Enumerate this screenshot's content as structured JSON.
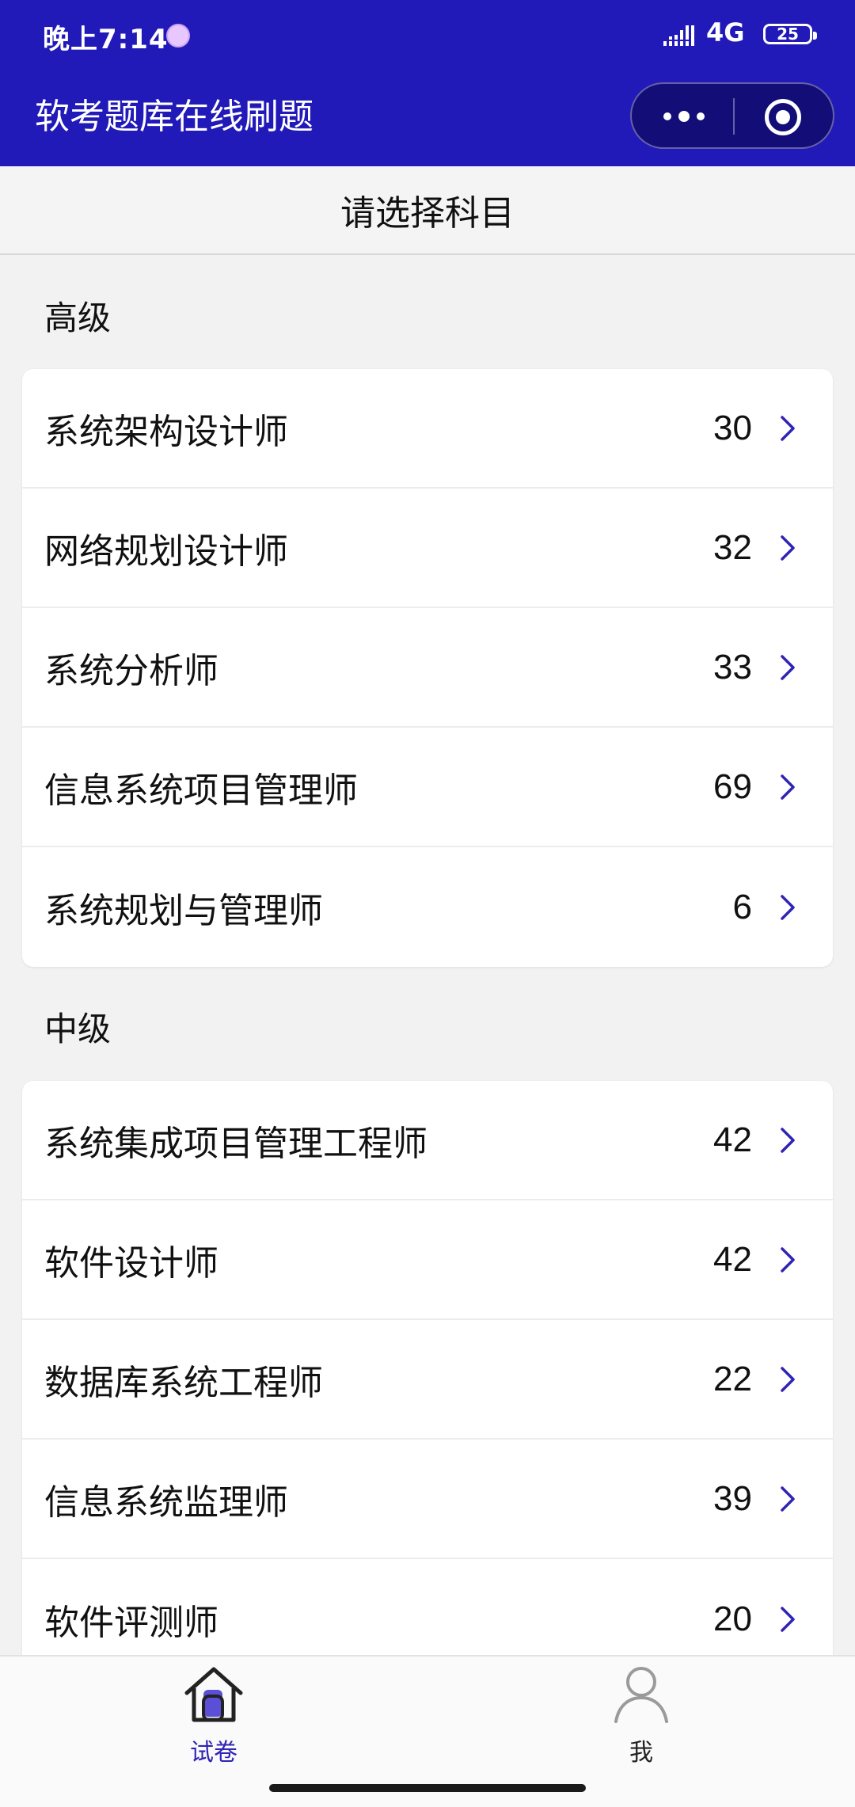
{
  "status": {
    "time": "晚上7:14",
    "network": "4G",
    "battery": "25"
  },
  "titlebar": {
    "title": "软考题库在线刷题",
    "more_icon": "more-dots-icon",
    "target_icon": "target-icon"
  },
  "header": {
    "title": "请选择科目"
  },
  "sections": [
    {
      "title": "高级",
      "items": [
        {
          "label": "系统架构设计师",
          "count": "30"
        },
        {
          "label": "网络规划设计师",
          "count": "32"
        },
        {
          "label": "系统分析师",
          "count": "33"
        },
        {
          "label": "信息系统项目管理师",
          "count": "69"
        },
        {
          "label": "系统规划与管理师",
          "count": "6"
        }
      ]
    },
    {
      "title": "中级",
      "items": [
        {
          "label": "系统集成项目管理工程师",
          "count": "42"
        },
        {
          "label": "软件设计师",
          "count": "42"
        },
        {
          "label": "数据库系统工程师",
          "count": "22"
        },
        {
          "label": "信息系统监理师",
          "count": "39"
        },
        {
          "label": "软件评测师",
          "count": "20"
        }
      ]
    }
  ],
  "nav": {
    "exam_label": "试卷",
    "me_label": "我"
  },
  "colors": {
    "accent": "#2119b8",
    "nav_active": "#2f24b5",
    "chevron": "#2f24b5"
  }
}
